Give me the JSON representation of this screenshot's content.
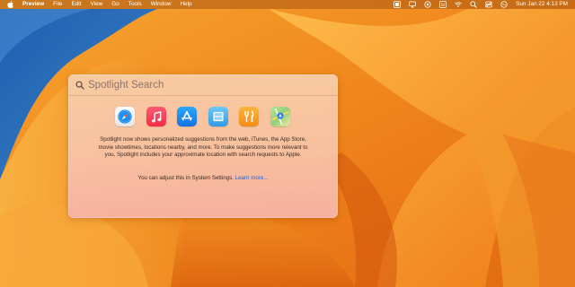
{
  "menubar": {
    "app_name": "Preview",
    "items": [
      "File",
      "Edit",
      "View",
      "Go",
      "Tools",
      "Window",
      "Help"
    ],
    "datetime": "Sun Jan 22  4:13 PM"
  },
  "spotlight": {
    "placeholder": "Spotlight Search",
    "apps": [
      "safari-icon",
      "music-icon",
      "app-store-icon",
      "simulator-icon",
      "food-icon",
      "maps-icon"
    ],
    "description": "Spotlight now shows personalized suggestions from the web, iTunes, the App Store, movie showtimes, locations nearby, and more. To make suggestions more relevant to you, Spotlight includes your approximate location with search requests to Apple.",
    "footer_text": "You can adjust this in System Settings.",
    "learn_more": "Learn more..."
  },
  "colors": {
    "accent_link": "#1f63d8",
    "wallpaper_orange": "#f08a1a",
    "wallpaper_blue": "#2a6db5"
  }
}
